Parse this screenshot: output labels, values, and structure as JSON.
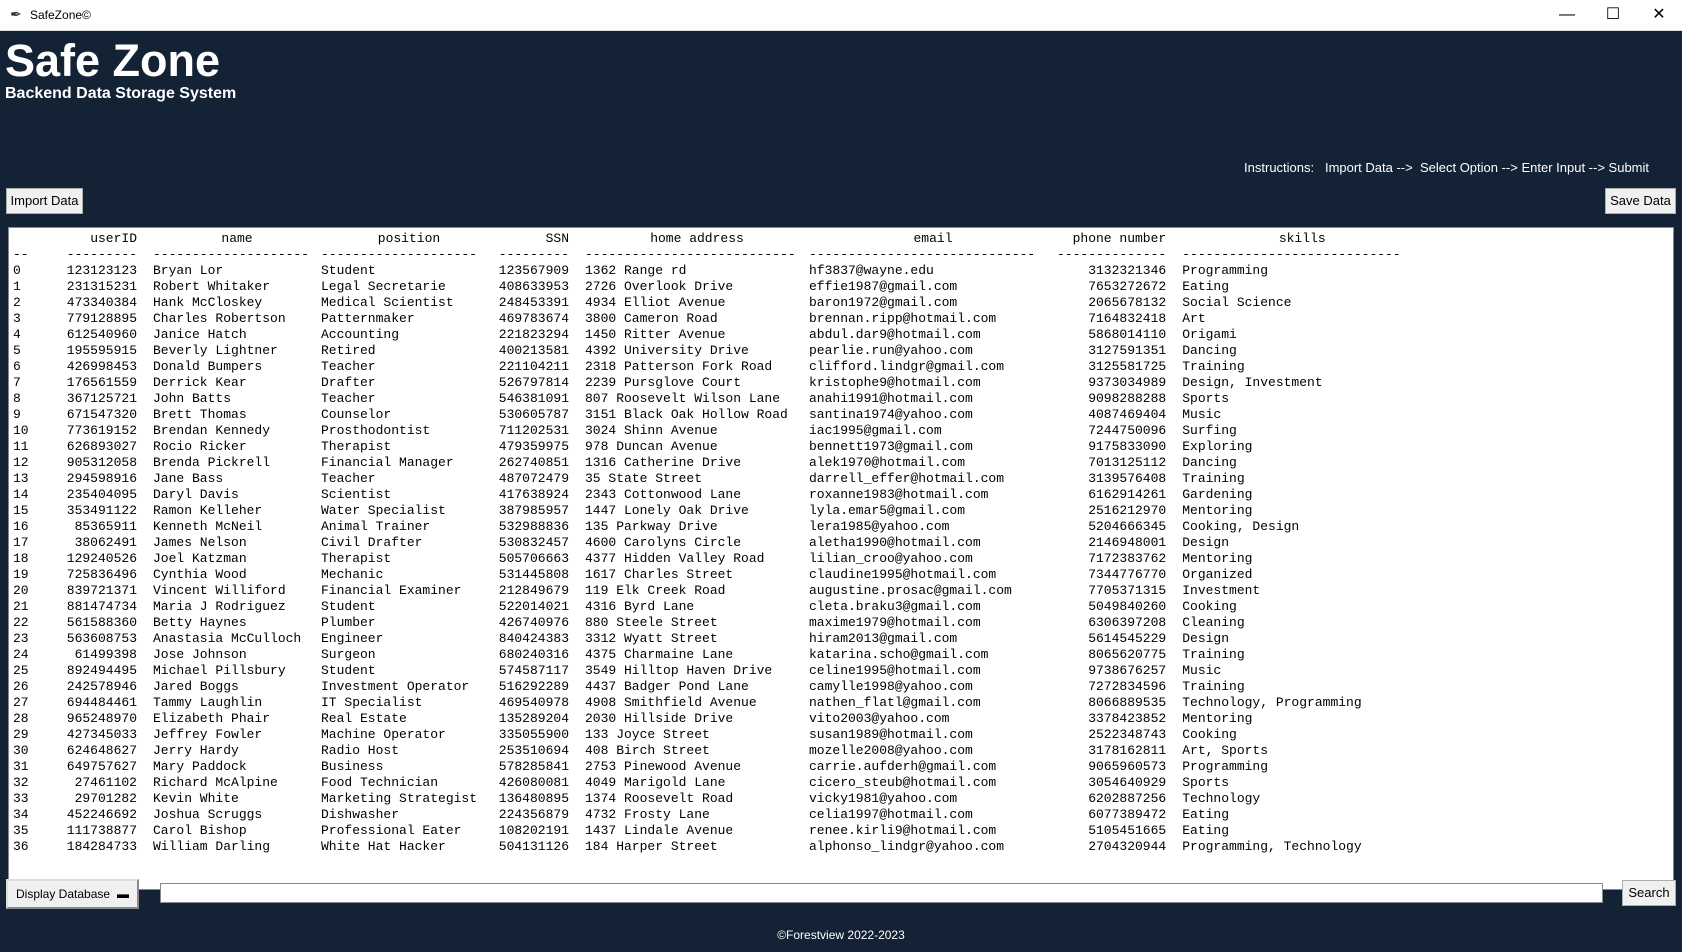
{
  "window": {
    "title": "SafeZone©",
    "minimize_glyph": "—",
    "maximize_glyph": "☐",
    "close_glyph": "✕"
  },
  "header": {
    "title": "Safe Zone",
    "subtitle": "Backend Data Storage System",
    "instructions": "Instructions:   Import Data -->  Select Option --> Enter Input --> Submit"
  },
  "toolbar": {
    "import_label": "Import Data",
    "save_label": "Save Data"
  },
  "table": {
    "headers": [
      "",
      "userID",
      "name",
      "position",
      "SSN",
      "home address",
      "email",
      "phone number",
      "skills"
    ],
    "separators": [
      "--",
      "---------",
      "--------------------",
      "--------------------",
      "---------",
      "---------------------------",
      "-----------------------------",
      "--------------",
      "----------------------------"
    ],
    "rows": [
      [
        "0",
        "123123123",
        "Bryan Lor",
        "Student",
        "123567909",
        "1362 Range rd",
        "hf3837@wayne.edu",
        "3132321346",
        "Programming"
      ],
      [
        "1",
        "231315231",
        "Robert Whitaker",
        "Legal Secretarie",
        "408633953",
        "2726 Overlook Drive",
        "effie1987@gmail.com",
        "7653272672",
        "Eating"
      ],
      [
        "2",
        "473340384",
        "Hank McCloskey",
        "Medical Scientist",
        "248453391",
        "4934 Elliot Avenue",
        "baron1972@gmail.com",
        "2065678132",
        "Social Science"
      ],
      [
        "3",
        "779128895",
        "Charles Robertson",
        "Patternmaker",
        "469783674",
        "3800 Cameron Road",
        "brennan.ripp@hotmail.com",
        "7164832418",
        "Art"
      ],
      [
        "4",
        "612540960",
        "Janice Hatch",
        "Accounting",
        "221823294",
        "1450 Ritter Avenue",
        "abdul.dar9@hotmail.com",
        "5868014110",
        "Origami"
      ],
      [
        "5",
        "195595915",
        "Beverly Lightner",
        "Retired",
        "400213581",
        "4392 University Drive",
        "pearlie.run@yahoo.com",
        "3127591351",
        "Dancing"
      ],
      [
        "6",
        "426998453",
        "Donald Bumpers",
        "Teacher",
        "221104211",
        "2318 Patterson Fork Road",
        "clifford.lindgr@gmail.com",
        "3125581725",
        "Training"
      ],
      [
        "7",
        "176561559",
        "Derrick Kear",
        "Drafter",
        "526797814",
        "2239 Pursglove Court",
        "kristophe9@hotmail.com",
        "9373034989",
        "Design, Investment"
      ],
      [
        "8",
        "367125721",
        "John Batts",
        "Teacher",
        "546381091",
        "807 Roosevelt Wilson Lane",
        "anahi1991@hotmail.com",
        "9098288288",
        "Sports"
      ],
      [
        "9",
        "671547320",
        "Brett Thomas",
        "Counselor",
        "530605787",
        "3151 Black Oak Hollow Road",
        "santina1974@yahoo.com",
        "4087469404",
        "Music"
      ],
      [
        "10",
        "773619152",
        "Brendan Kennedy",
        "Prosthodontist",
        "711202531",
        "3024 Shinn Avenue",
        "iac1995@gmail.com",
        "7244750096",
        "Surfing"
      ],
      [
        "11",
        "626893027",
        "Rocio Ricker",
        "Therapist",
        "479359975",
        "978 Duncan Avenue",
        "bennett1973@gmail.com",
        "9175833090",
        "Exploring"
      ],
      [
        "12",
        "905312058",
        "Brenda Pickrell",
        "Financial Manager",
        "262740851",
        "1316 Catherine Drive",
        "alek1970@hotmail.com",
        "7013125112",
        "Dancing"
      ],
      [
        "13",
        "294598916",
        "Jane Bass",
        "Teacher",
        "487072479",
        "35 State Street",
        "darrell_effer@hotmail.com",
        "3139576408",
        "Training"
      ],
      [
        "14",
        "235404095",
        "Daryl Davis",
        "Scientist",
        "417638924",
        "2343 Cottonwood Lane",
        "roxanne1983@hotmail.com",
        "6162914261",
        "Gardening"
      ],
      [
        "15",
        "353491122",
        "Ramon Kelleher",
        "Water Specialist",
        "387985957",
        "1447 Lonely Oak Drive",
        "lyla.emar5@gmail.com",
        "2516212970",
        "Mentoring"
      ],
      [
        "16",
        "85365911",
        "Kenneth McNeil",
        "Animal Trainer",
        "532988836",
        "135 Parkway Drive",
        "lera1985@yahoo.com",
        "5204666345",
        "Cooking, Design"
      ],
      [
        "17",
        "38062491",
        "James Nelson",
        "Civil Drafter",
        "530832457",
        "4600 Carolyns Circle",
        "aletha1990@hotmail.com",
        "2146948001",
        "Design"
      ],
      [
        "18",
        "129240526",
        "Joel Katzman",
        "Therapist",
        "505706663",
        "4377 Hidden Valley Road",
        "lilian_croo@yahoo.com",
        "7172383762",
        "Mentoring"
      ],
      [
        "19",
        "725836496",
        "Cynthia Wood",
        "Mechanic",
        "531445808",
        "1617 Charles Street",
        "claudine1995@hotmail.com",
        "7344776770",
        "Organized"
      ],
      [
        "20",
        "839721371",
        "Vincent Williford",
        "Financial Examiner",
        "212849679",
        "119 Elk Creek Road",
        "augustine.prosac@gmail.com",
        "7705371315",
        "Investment"
      ],
      [
        "21",
        "881474734",
        "Maria J Rodriguez",
        "Student",
        "522014021",
        "4316 Byrd Lane",
        "cleta.braku3@gmail.com",
        "5049840260",
        "Cooking"
      ],
      [
        "22",
        "561588360",
        "Betty Haynes",
        "Plumber",
        "426740976",
        "880 Steele Street",
        "maxime1979@hotmail.com",
        "6306397208",
        "Cleaning"
      ],
      [
        "23",
        "563608753",
        "Anastasia McCulloch",
        "Engineer",
        "840424383",
        "3312 Wyatt Street",
        "hiram2013@gmail.com",
        "5614545229",
        "Design"
      ],
      [
        "24",
        "61499398",
        "Jose Johnson",
        "Surgeon",
        "680240316",
        "4375 Charmaine Lane",
        "katarina.scho@gmail.com",
        "8065620775",
        "Training"
      ],
      [
        "25",
        "892494495",
        "Michael Pillsbury",
        "Student",
        "574587117",
        "3549 Hilltop Haven Drive",
        "celine1995@hotmail.com",
        "9738676257",
        "Music"
      ],
      [
        "26",
        "242578946",
        "Jared Boggs",
        "Investment Operator",
        "516292289",
        "4437 Badger Pond Lane",
        "camylle1998@yahoo.com",
        "7272834596",
        "Training"
      ],
      [
        "27",
        "694484461",
        "Tammy Laughlin",
        "IT Specialist",
        "469540978",
        "4908 Smithfield Avenue",
        "nathen_flatl@gmail.com",
        "8066889535",
        "Technology, Programming"
      ],
      [
        "28",
        "965248970",
        "Elizabeth Phair",
        "Real Estate",
        "135289204",
        "2030 Hillside Drive",
        "vito2003@yahoo.com",
        "3378423852",
        "Mentoring"
      ],
      [
        "29",
        "427345033",
        "Jeffrey Fowler",
        "Machine Operator",
        "335055900",
        "133 Joyce Street",
        "susan1989@hotmail.com",
        "2522348743",
        "Cooking"
      ],
      [
        "30",
        "624648627",
        "Jerry Hardy",
        "Radio Host",
        "253510694",
        "408 Birch Street",
        "mozelle2008@yahoo.com",
        "3178162811",
        "Art, Sports"
      ],
      [
        "31",
        "649757627",
        "Mary Paddock",
        "Business",
        "578285841",
        "2753 Pinewood Avenue",
        "carrie.aufderh@gmail.com",
        "9065960573",
        "Programming"
      ],
      [
        "32",
        "27461102",
        "Richard McAlpine",
        "Food Technician",
        "426080081",
        "4049 Marigold Lane",
        "cicero_steub@hotmail.com",
        "3054640929",
        "Sports"
      ],
      [
        "33",
        "29701282",
        "Kevin White",
        "Marketing Strategist",
        "136480895",
        "1374 Roosevelt Road",
        "vicky1981@yahoo.com",
        "6202887256",
        "Technology"
      ],
      [
        "34",
        "452246692",
        "Joshua Scruggs",
        "Dishwasher",
        "224356879",
        "4732 Frosty Lane",
        "celia1997@hotmail.com",
        "6077389472",
        "Eating"
      ],
      [
        "35",
        "111738877",
        "Carol Bishop",
        "Professional Eater",
        "108202191",
        "1437 Lindale Avenue",
        "renee.kirli9@hotmail.com",
        "5105451665",
        "Eating"
      ],
      [
        "36",
        "184284733",
        "William Darling",
        "White Hat Hacker",
        "504131126",
        "184 Harper Street",
        "alphonso_lindgr@yahoo.com",
        "2704320944",
        "Programming, Technology"
      ]
    ]
  },
  "bottom": {
    "display_option": "Display Database",
    "search_value": "",
    "search_label": "Search",
    "copyright": "©Forestview 2022-2023"
  },
  "colors": {
    "background": "#132234",
    "text": "#ffffff"
  }
}
